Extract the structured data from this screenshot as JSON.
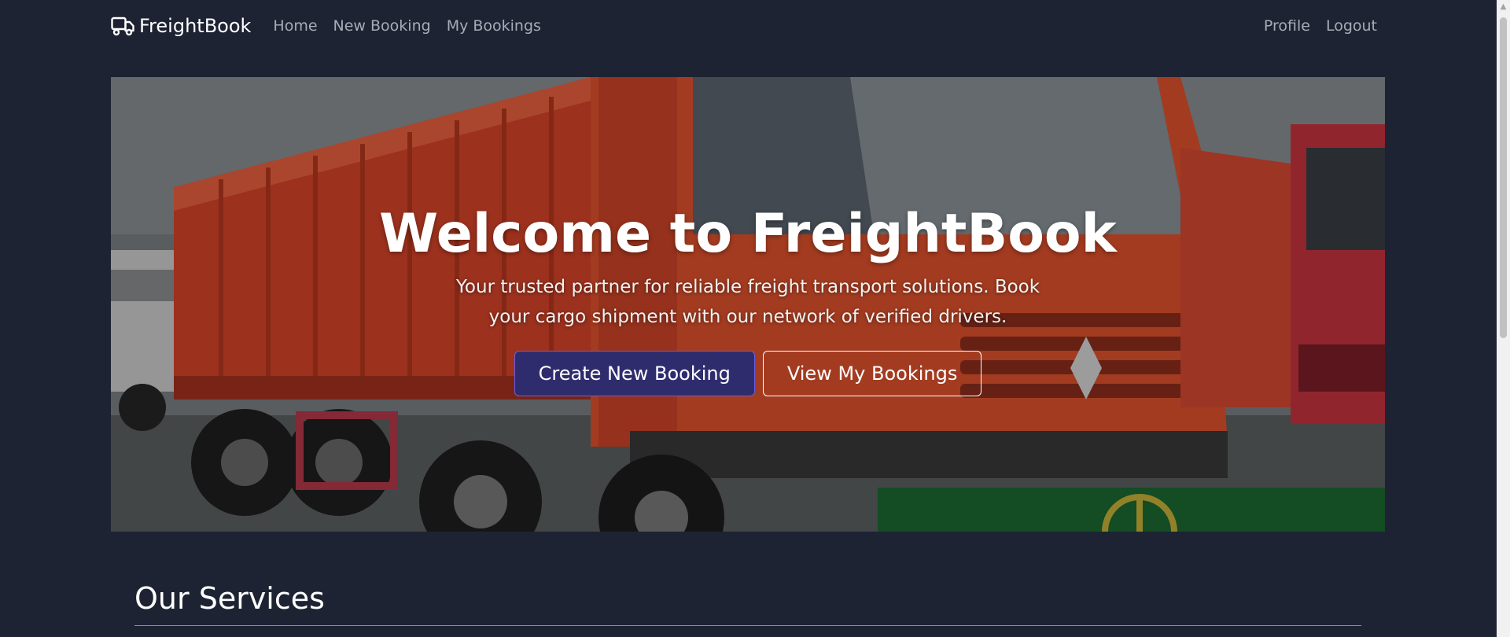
{
  "navbar": {
    "brand": "FreightBook",
    "brand_icon": "truck-icon",
    "links": [
      "Home",
      "New Booking",
      "My Bookings"
    ],
    "right_links": [
      "Profile",
      "Logout"
    ]
  },
  "hero": {
    "title": "Welcome to FreightBook",
    "subtitle": "Your trusted partner for reliable freight transport solutions. Book your cargo shipment with our network of verified drivers.",
    "primary_button": "Create New Booking",
    "secondary_button": "View My Bookings"
  },
  "services": {
    "title": "Our Services"
  },
  "colors": {
    "background": "#1d2333",
    "primary_button": "#2f2c6e",
    "truck": "#e8502a"
  }
}
